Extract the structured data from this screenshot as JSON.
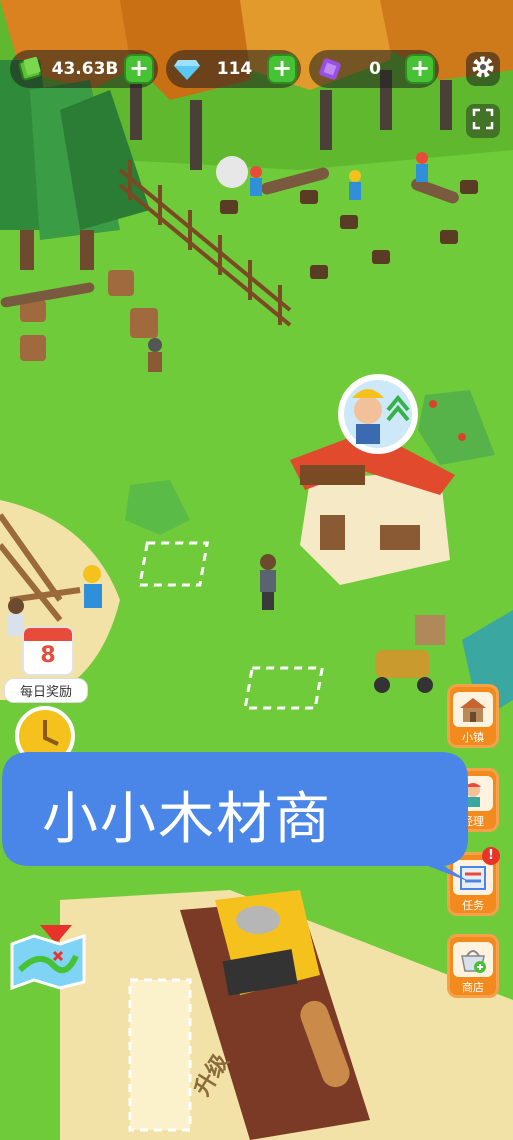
{
  "hud": {
    "cash": "43.63B",
    "gems": "114",
    "tickets": "0"
  },
  "icons": {
    "cash": "cash-stack-icon",
    "gems": "diamond-icon",
    "tickets": "purple-ticket-icon",
    "settings": "gear-icon",
    "fullscreen": "fullscreen-icon",
    "map": "map-icon"
  },
  "daily": {
    "day": "8",
    "label": "每日奖励"
  },
  "side_buttons": [
    {
      "label": "小镇",
      "icon": "house-icon"
    },
    {
      "label": "经理",
      "icon": "manager-icon"
    },
    {
      "label": "任务",
      "icon": "task-board-icon"
    },
    {
      "label": "商店",
      "icon": "shop-basket-icon"
    }
  ],
  "banner": {
    "title": "小小木材商"
  },
  "ground_text": "升级",
  "colors": {
    "grass": "#6fcb3a",
    "accent_green": "#47c234",
    "banner_blue": "#4a86e8",
    "button_orange": "#f28a1d"
  }
}
